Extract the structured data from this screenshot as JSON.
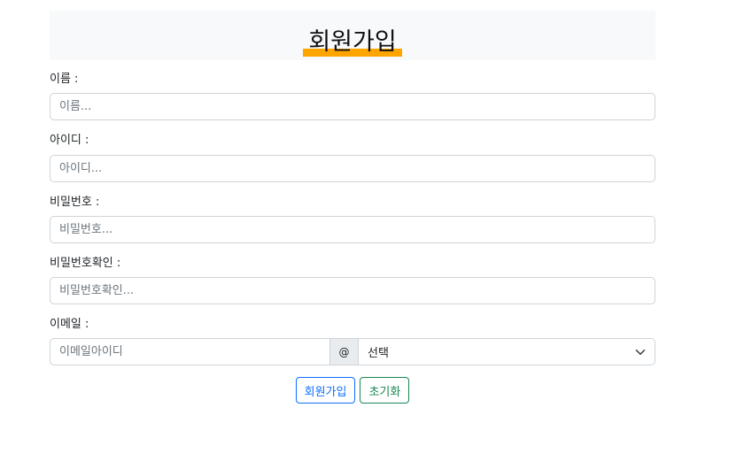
{
  "page": {
    "title": "회원가입"
  },
  "form": {
    "name": {
      "label": "이름 :",
      "placeholder": "이름..."
    },
    "userid": {
      "label": "아이디 :",
      "placeholder": "아이디..."
    },
    "password": {
      "label": "비밀번호 :",
      "placeholder": "비밀번호..."
    },
    "password_confirm": {
      "label": "비밀번호확인 :",
      "placeholder": "비밀번호확인..."
    },
    "email": {
      "label": "이메일 :",
      "id_placeholder": "이메일아이디",
      "at_symbol": "@",
      "domain_selected": "선택"
    }
  },
  "buttons": {
    "submit_label": "회원가입",
    "reset_label": "초기화"
  },
  "colors": {
    "title_highlight": "#ffa500",
    "primary": "#0d6efd",
    "success": "#198754",
    "header_bg": "#f8f9fa"
  }
}
